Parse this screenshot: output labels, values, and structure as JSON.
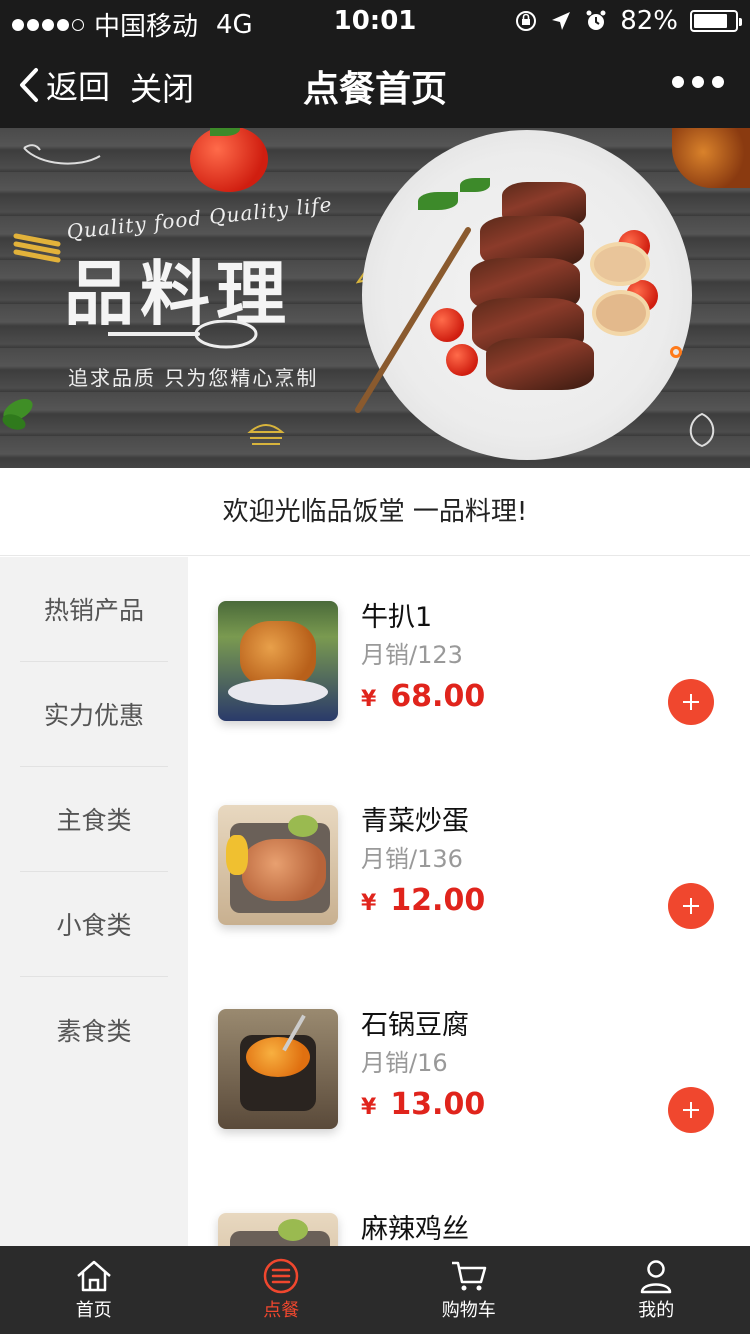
{
  "status_bar": {
    "carrier": "中国移动",
    "network": "4G",
    "time": "10:01",
    "battery": "82%",
    "battery_level": 0.82,
    "signal_bars": 4
  },
  "navbar": {
    "back_label": "返回",
    "close_label": "关闭",
    "title": "点餐首页",
    "more_icon": "more-dots-icon"
  },
  "banner": {
    "tagline_en": "Quality food Quality life",
    "brand": "品料理",
    "slogan": "追求品质 只为您精心烹制"
  },
  "welcome": "欢迎光临品饭堂 一品料理!",
  "categories": [
    {
      "label": "热销产品"
    },
    {
      "label": "实力优惠"
    },
    {
      "label": "主食类"
    },
    {
      "label": "小食类"
    },
    {
      "label": "素食类"
    }
  ],
  "products": [
    {
      "name": "牛扒1",
      "sales": "月销/123",
      "currency": "¥",
      "price": "68.00"
    },
    {
      "name": "青菜炒蛋",
      "sales": "月销/136",
      "currency": "¥",
      "price": "12.00"
    },
    {
      "name": "石锅豆腐",
      "sales": "月销/16",
      "currency": "¥",
      "price": "13.00"
    },
    {
      "name": "麻辣鸡丝"
    }
  ],
  "tabbar": [
    {
      "label": "首页",
      "icon": "home-icon"
    },
    {
      "label": "点餐",
      "icon": "order-menu-icon",
      "active": true
    },
    {
      "label": "购物车",
      "icon": "cart-icon"
    },
    {
      "label": "我的",
      "icon": "user-icon"
    }
  ],
  "colors": {
    "accent": "#f0472e",
    "price": "#e0241c",
    "header_bg": "#1b1b1b",
    "tabbar_bg": "#2b2b2b",
    "sidebar_bg": "#f2f2f2"
  }
}
